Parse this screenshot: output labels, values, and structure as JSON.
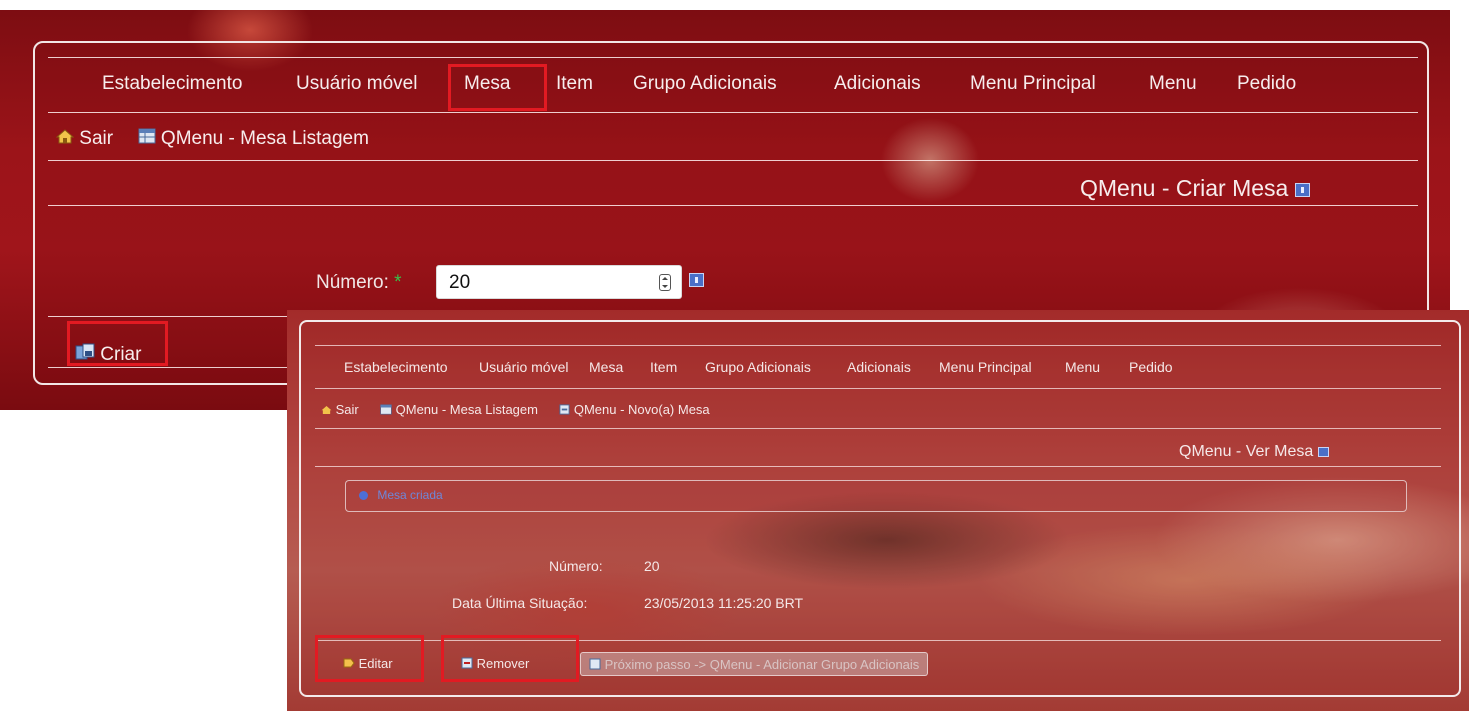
{
  "screen1": {
    "menu": [
      "Estabelecimento",
      "Usuário móvel",
      "Mesa",
      "Item",
      "Grupo Adicionais",
      "Adicionais",
      "Menu Principal",
      "Menu",
      "Pedido"
    ],
    "breadcrumb": {
      "sair": "Sair",
      "listagem": "QMenu - Mesa Listagem"
    },
    "page_title": "QMenu - Criar Mesa",
    "form": {
      "numero_label": "Número:",
      "required_mark": "*",
      "numero_value": "20"
    },
    "criar_label": "Criar"
  },
  "screen2": {
    "menu": [
      "Estabelecimento",
      "Usuário móvel",
      "Mesa",
      "Item",
      "Grupo Adicionais",
      "Adicionais",
      "Menu Principal",
      "Menu",
      "Pedido"
    ],
    "breadcrumb": {
      "sair": "Sair",
      "listagem": "QMenu - Mesa Listagem",
      "novo": "QMenu - Novo(a) Mesa"
    },
    "page_title": "QMenu - Ver Mesa",
    "message": "Mesa criada",
    "fields": {
      "numero_label": "Número:",
      "numero_value": "20",
      "data_label": "Data Última Situação:",
      "data_value": "23/05/2013 11:25:20 BRT"
    },
    "buttons": {
      "editar": "Editar",
      "remover": "Remover",
      "proximo": "Próximo passo -> QMenu - Adicionar Grupo Adicionais"
    }
  }
}
